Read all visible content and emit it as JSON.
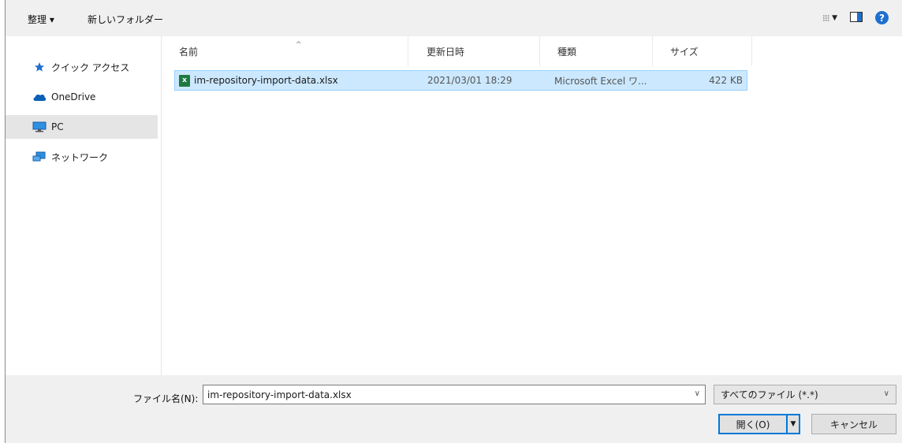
{
  "toolbar": {
    "organize_label": "整理 ▾",
    "new_folder_label": "新しいフォルダー",
    "icons": [
      "view-options-icon",
      "chevron-down-icon",
      "preview-pane-icon",
      "help-icon"
    ]
  },
  "nav": {
    "items": [
      {
        "label": "クイック アクセス",
        "icon": "star-icon"
      },
      {
        "label": "OneDrive",
        "icon": "cloud-icon"
      },
      {
        "label": "PC",
        "icon": "monitor-icon",
        "selected": true
      },
      {
        "label": "ネットワーク",
        "icon": "network-icon"
      }
    ]
  },
  "columns": [
    "名前",
    "更新日時",
    "種類",
    "サイズ"
  ],
  "files": [
    {
      "name": "im-repository-import-data.xlsx",
      "modified": "2021/03/01 18:29",
      "type": "Microsoft Excel ワ...",
      "size": "422 KB",
      "icon": "excel-file-icon"
    }
  ],
  "bottom": {
    "filename_label": "ファイル名(N):",
    "filename_value": "im-repository-import-data.xlsx",
    "filetype_value": "すべてのファイル (*.*)",
    "open_label": "開く(O)",
    "cancel_label": "キャンセル"
  },
  "colors": {
    "selection": "#cce8ff",
    "selection_border": "#99d1ff",
    "accent": "#0078d7",
    "help": "#1f6fd0",
    "excel": "#1f7a42"
  }
}
